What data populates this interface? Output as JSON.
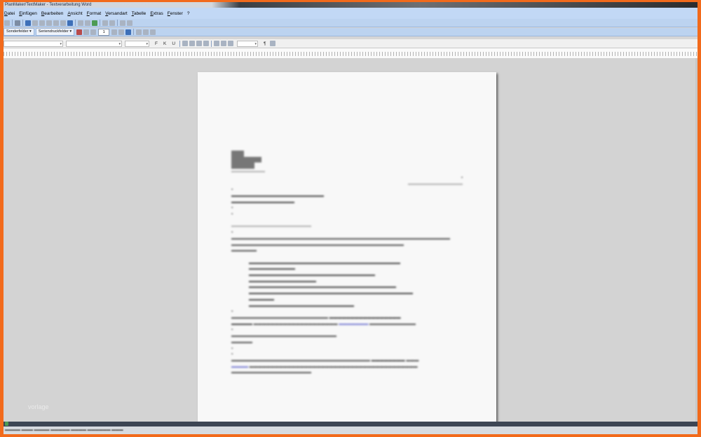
{
  "window": {
    "title": "PlanMaker/TextMaker - Textverarbeitung Word"
  },
  "menu": [
    "Datei",
    "Einfügen",
    "Bearbeiten",
    "Ansicht",
    "Format",
    "Versandart",
    "Tabelle",
    "Extras",
    "Fenster",
    "?"
  ],
  "toolbar2": {
    "sonderfelder": "Sonderfelder ▾",
    "seriendruckfelder": "Seriendruckfelder ▾",
    "record_number": "1"
  },
  "format_bar": {
    "bold": "F",
    "italic": "K",
    "underline": "U",
    "pilcrow": "¶"
  },
  "watermark": "vorlage",
  "colors": {
    "border": "#f26a1b",
    "menubar": "#c2d8f5",
    "workspace": "#d3d3d3",
    "page": "#f8f8f8"
  }
}
